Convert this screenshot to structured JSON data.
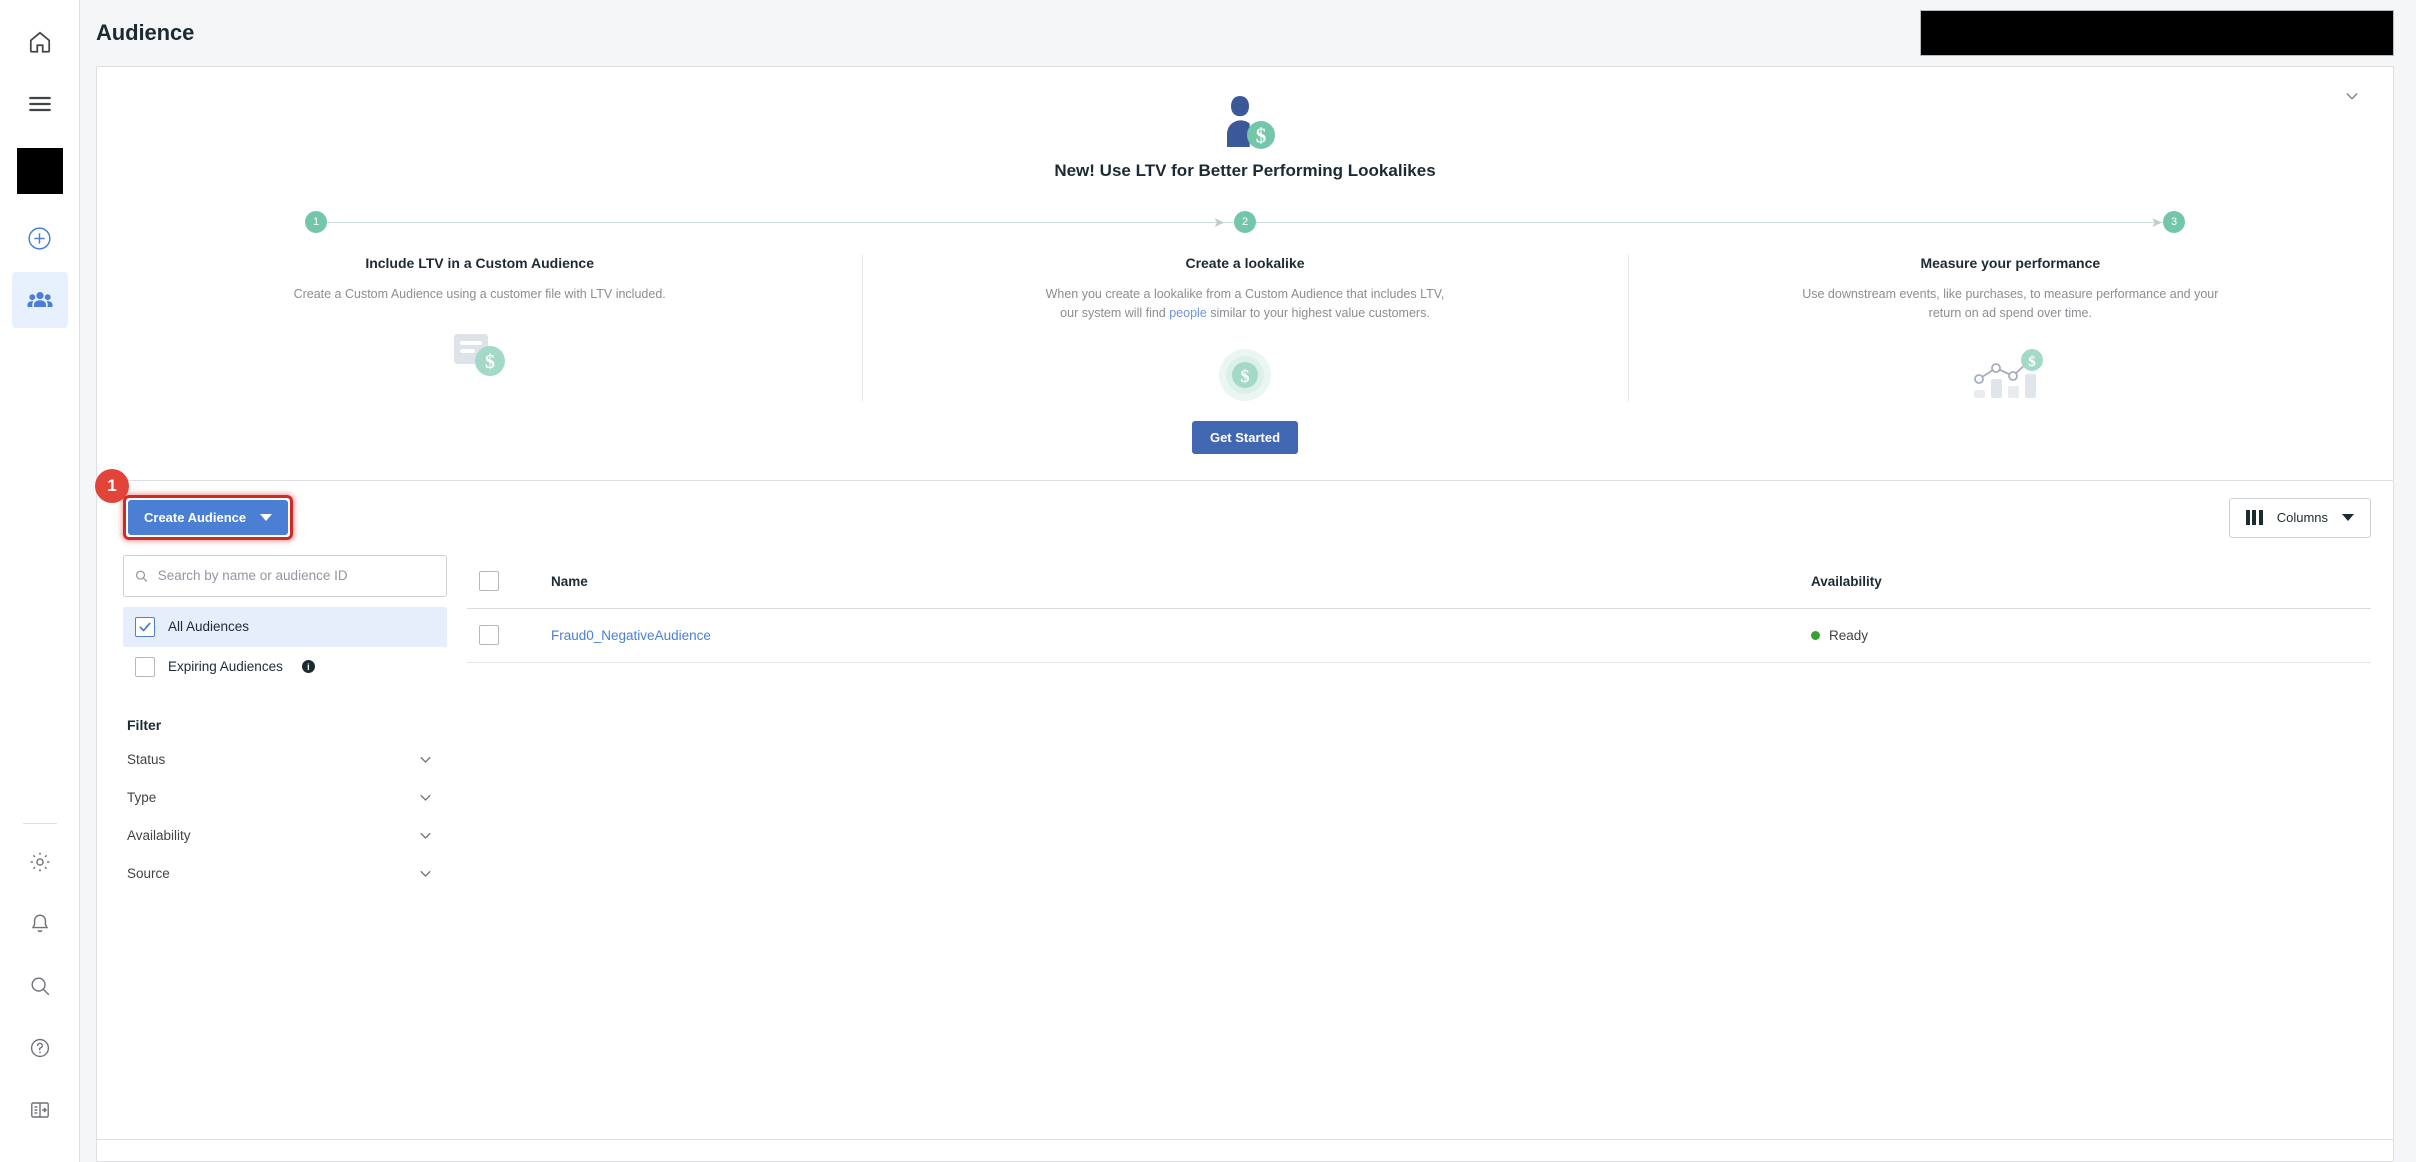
{
  "rail": {
    "items": [
      {
        "name": "home-icon",
        "label": "Home"
      },
      {
        "name": "menu-icon",
        "label": "All tools"
      },
      {
        "name": "account-swatch",
        "label": "Account"
      },
      {
        "name": "plus-circle-icon",
        "label": "Create"
      },
      {
        "name": "audience-people-icon",
        "label": "Audiences"
      }
    ],
    "bottom_items": [
      {
        "name": "gear-icon",
        "label": "Settings"
      },
      {
        "name": "bell-icon",
        "label": "Notifications"
      },
      {
        "name": "search-icon",
        "label": "Search"
      },
      {
        "name": "help-circle-icon",
        "label": "Help"
      },
      {
        "name": "panel-toggle-icon",
        "label": "Toggle panel"
      }
    ]
  },
  "header": {
    "title": "Audience"
  },
  "promo": {
    "title": "New! Use LTV for Better Performing Lookalikes",
    "collapse_icon": "chevron-down-icon",
    "hero_icon": "person-dollar-icon",
    "steps": [
      "1",
      "2",
      "3"
    ],
    "columns": [
      {
        "heading": "Include LTV in a Custom Audience",
        "body": "Create a Custom Audience using a customer file with LTV included.",
        "art": "file-dollar-icon"
      },
      {
        "heading": "Create a lookalike",
        "body_before": "When you create a lookalike from a Custom Audience that includes LTV, our system will find ",
        "body_link": "people",
        "body_after": " similar to your highest value customers.",
        "art": "coin-dollar-icon"
      },
      {
        "heading": "Measure your performance",
        "body": "Use downstream events, like purchases, to measure performance and your return on ad spend over time.",
        "art": "chart-dollar-icon"
      }
    ],
    "cta_label": "Get Started"
  },
  "toolbar": {
    "badge_number": "1",
    "create_label": "Create Audience",
    "columns_label": "Columns",
    "columns_icon": "columns-glyph-icon"
  },
  "filters": {
    "search_placeholder": "Search by name or audience ID",
    "search_value": "",
    "search_icon": "search-icon",
    "options": [
      {
        "label": "All Audiences",
        "checked": true
      },
      {
        "label": "Expiring Audiences",
        "checked": false,
        "info": "i"
      }
    ],
    "filter_heading": "Filter",
    "groups": [
      {
        "label": "Status",
        "icon": "chevron-down-icon"
      },
      {
        "label": "Type",
        "icon": "chevron-down-icon"
      },
      {
        "label": "Availability",
        "icon": "chevron-down-icon"
      },
      {
        "label": "Source",
        "icon": "chevron-down-icon"
      }
    ]
  },
  "table": {
    "columns": [
      "Name",
      "Availability"
    ],
    "rows": [
      {
        "name": "Fraud0_NegativeAudience",
        "availability": "Ready",
        "status_color": "#37a32f"
      }
    ]
  },
  "colors": {
    "primary_blue": "#4a7fd4",
    "cta_blue": "#4267b2",
    "accent_red": "#e3443a",
    "step_green": "#73c6a8",
    "ready_green": "#37a32f"
  }
}
